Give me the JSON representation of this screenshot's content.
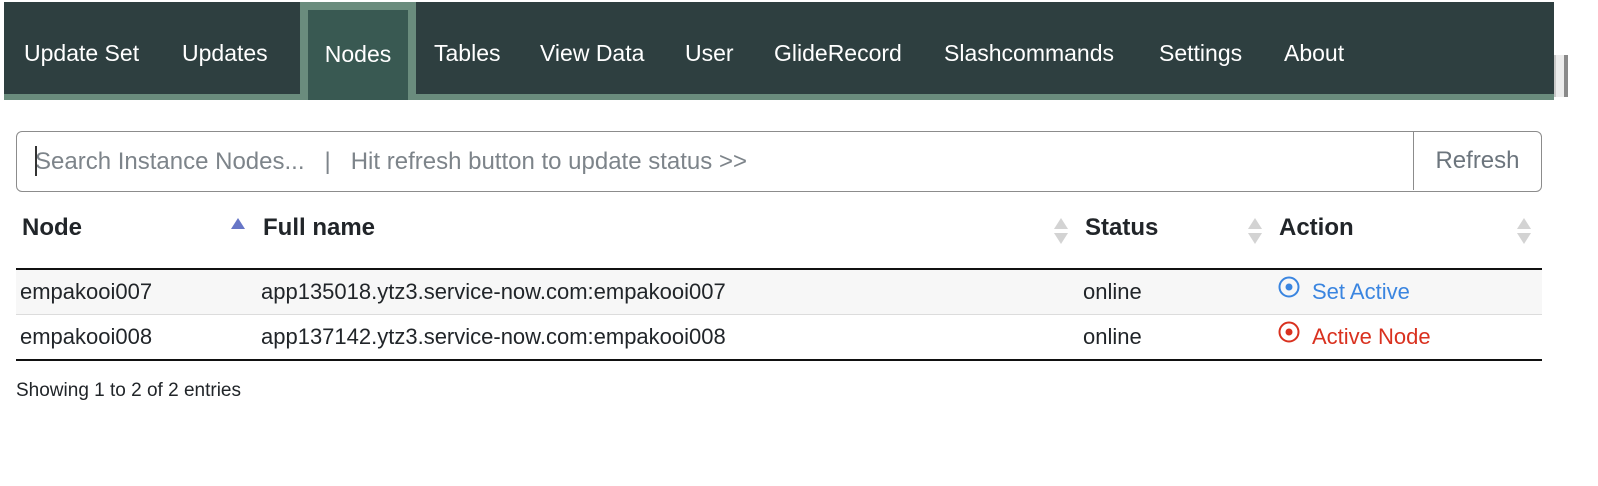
{
  "nav": {
    "tabs": [
      {
        "label": "Update Set"
      },
      {
        "label": "Updates"
      },
      {
        "label": "Nodes",
        "active": true
      },
      {
        "label": "Tables"
      },
      {
        "label": "View Data"
      },
      {
        "label": "User"
      },
      {
        "label": "GlideRecord"
      },
      {
        "label": "Slashcommands"
      },
      {
        "label": "Settings"
      },
      {
        "label": "About"
      }
    ]
  },
  "search": {
    "placeholder": "Search Instance Nodes...   |   Hit refresh button to update status >>",
    "value": "",
    "refresh_label": "Refresh"
  },
  "table": {
    "columns": [
      "Node",
      "Full name",
      "Status",
      "Action"
    ],
    "sorted_column": "Node",
    "rows": [
      {
        "node": "empakooi007",
        "full_name": "app135018.ytz3.service-now.com:empakooi007",
        "status": "online",
        "action": "Set Active",
        "action_icon": "target-icon"
      },
      {
        "node": "empakooi008",
        "full_name": "app137142.ytz3.service-now.com:empakooi008",
        "status": "online",
        "action": "Active Node",
        "action_icon": "target-icon"
      }
    ],
    "info": "Showing 1 to 2 of 2 entries"
  },
  "colors": {
    "nav_bg": "#2e3f40",
    "nav_active_bg": "#395952",
    "nav_border": "#6a8c7d",
    "set_active": "#3a85e0",
    "active_node": "#d9311f",
    "sort_asc": "#6776c7",
    "sort_idle": "#d3d3d3"
  }
}
